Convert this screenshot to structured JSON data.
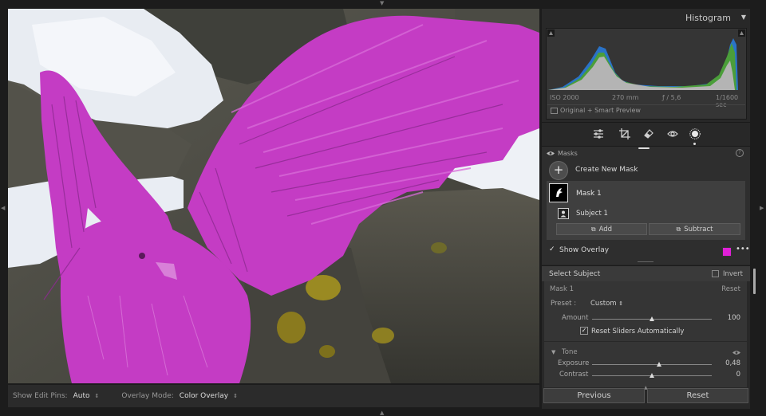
{
  "histogram": {
    "title": "Histogram",
    "iso": "ISO 2000",
    "focal": "270 mm",
    "aperture": "ƒ / 5,6",
    "shutter": "1/1600 sec",
    "preview": "Original + Smart Preview"
  },
  "tools": [
    "edit-sliders-icon",
    "crop-icon",
    "heal-icon",
    "red-eye-icon",
    "masking-icon"
  ],
  "masks": {
    "label": "Masks",
    "create_label": "Create New Mask",
    "mask_name": "Mask 1",
    "component_name": "Subject 1",
    "add_label": "Add",
    "subtract_label": "Subtract",
    "show_overlay_label": "Show Overlay",
    "show_overlay_checked": true,
    "overlay_color": "#e020d8"
  },
  "select_subject": {
    "label": "Select Subject",
    "invert_label": "Invert",
    "invert_checked": false
  },
  "mask_settings": {
    "title": "Mask 1",
    "reset_label": "Reset",
    "preset_label": "Preset :",
    "preset_value": "Custom",
    "amount_label": "Amount",
    "amount_value": "100",
    "amount_fraction": 0.5,
    "reset_sliders_label": "Reset Sliders Automatically",
    "reset_sliders_checked": true,
    "tone_label": "Tone",
    "exposure_label": "Exposure",
    "exposure_value": "0,48",
    "exposure_fraction": 0.56,
    "contrast_label": "Contrast",
    "contrast_value": "0",
    "contrast_fraction": 0.5
  },
  "footer": {
    "previous_label": "Previous",
    "reset_label": "Reset"
  },
  "bottom_bar": {
    "edit_pins_label": "Show Edit Pins:",
    "edit_pins_value": "Auto",
    "overlay_mode_label": "Overlay Mode:",
    "overlay_mode_value": "Color Overlay"
  },
  "chevron_glyph": "⌃⌄"
}
